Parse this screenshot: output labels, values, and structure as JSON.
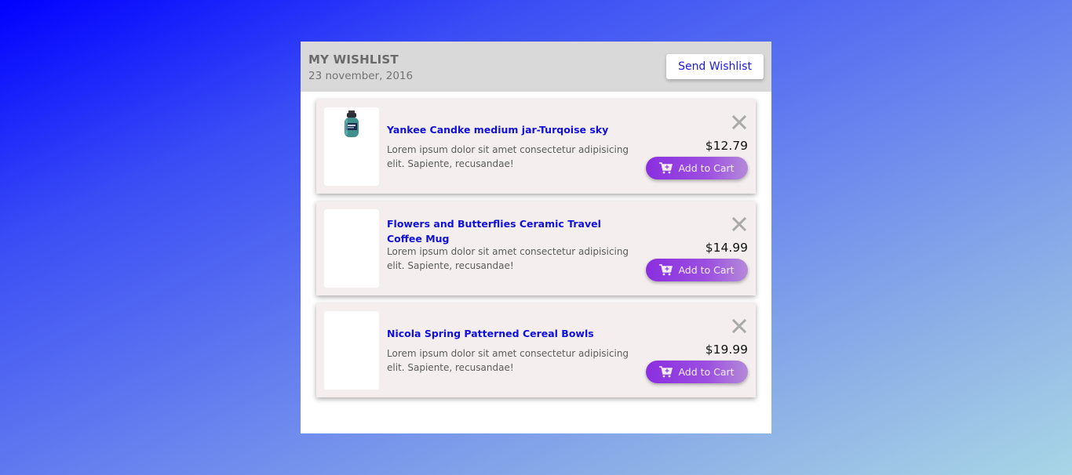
{
  "header": {
    "title": "MY WISHLIST",
    "date": "23 november, 2016",
    "send_label": "Send Wishlist"
  },
  "items": [
    {
      "title": "Yankee Candke medium jar-Turqoise sky",
      "description": "Lorem ipsum dolor sit amet consectetur adipisicing elit. Sapiente, recusandae!",
      "price": "$12.79",
      "cart_label": "Add to Cart"
    },
    {
      "title": "Flowers and Butterflies Ceramic Travel Coffee Mug",
      "description": "Lorem ipsum dolor sit amet consectetur adipisicing elit. Sapiente, recusandae!",
      "price": "$14.99",
      "cart_label": "Add to Cart"
    },
    {
      "title": "Nicola Spring Patterned Cereal Bowls",
      "description": "Lorem ipsum dolor sit amet consectetur adipisicing elit. Sapiente, recusandae!",
      "price": "$19.99",
      "cart_label": "Add to Cart"
    }
  ],
  "icons": {
    "remove": "close-icon",
    "cart": "add-to-cart-icon",
    "thumbnail": "candle-jar-image"
  },
  "colors": {
    "title_blue": "#1010dd",
    "button_purple": "#8a2ee0",
    "header_gray": "#d9d9d9",
    "card_bg": "#f4eeee"
  }
}
